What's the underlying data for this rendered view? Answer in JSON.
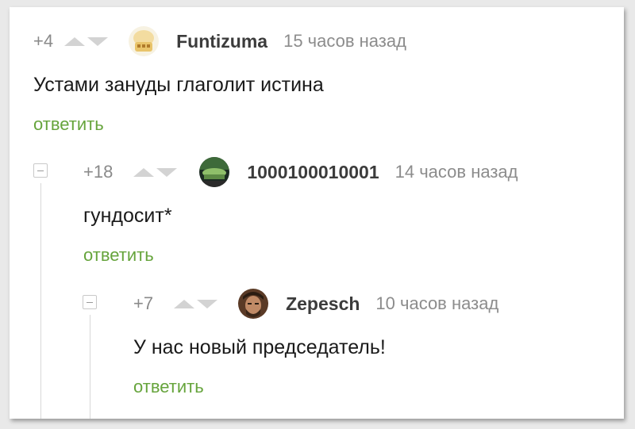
{
  "comments": [
    {
      "score": "+4",
      "username": "Funtizuma",
      "time": "15 часов назад",
      "text": "Устами зануды глаголит истина",
      "reply_label": "ответить"
    },
    {
      "score": "+18",
      "username": "1000100010001",
      "time": "14 часов назад",
      "text": "гундосит*",
      "reply_label": "ответить"
    },
    {
      "score": "+7",
      "username": "Zepesch",
      "time": "10 часов назад",
      "text": "У нас новый председатель!",
      "reply_label": "ответить"
    }
  ],
  "colors": {
    "reply_link": "#66a43c",
    "score": "#8a8a8a",
    "username": "#3c3c3c",
    "vote_arrow": "#d3d3d3"
  }
}
